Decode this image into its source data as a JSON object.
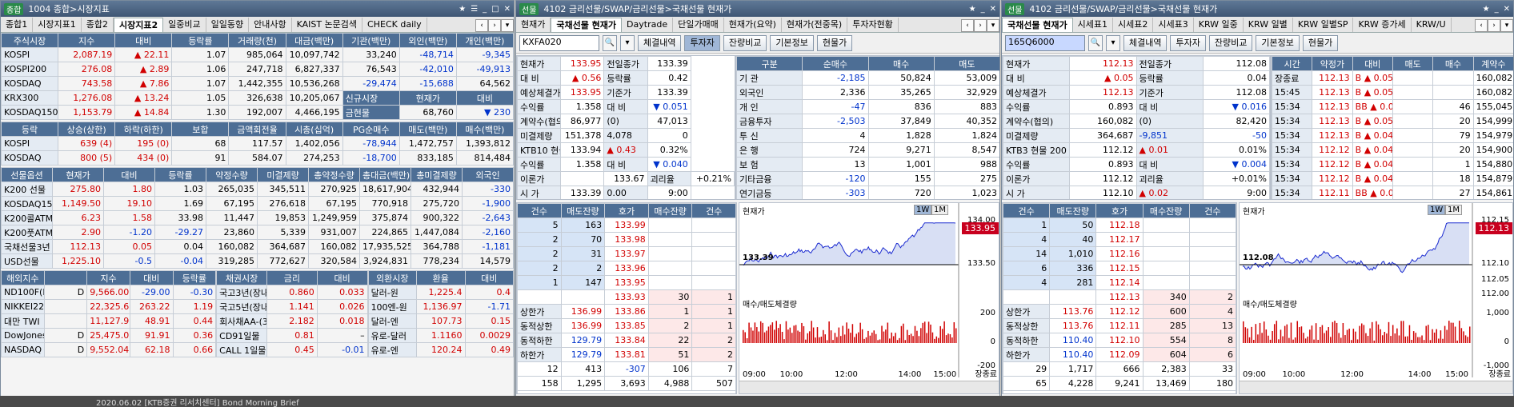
{
  "win1": {
    "title": "1004 종합>시장지표",
    "logo": "종합",
    "tabs": [
      "종합1",
      "시장지표1",
      "종합2",
      "시장지표2",
      "일중비교",
      "일일동향",
      "안내사항",
      "KAIST 논문검색",
      "CHECK daily"
    ],
    "stocks": {
      "headers": [
        "주식시장",
        "지수",
        "대비",
        "등락률",
        "거래량(천)",
        "대금(백만)",
        "기관(백만)",
        "외인(백만)",
        "개인(백만)"
      ],
      "rows": [
        [
          "KOSPI",
          "2,087.19",
          "▲ 22.11",
          "1.07",
          "985,064",
          "10,097,742",
          "33,240",
          "-48,714",
          "-9,345"
        ],
        [
          "KOSPI200",
          "276.08",
          "▲ 2.89",
          "1.06",
          "247,718",
          "6,827,337",
          "76,543",
          "-42,010",
          "-49,913"
        ],
        [
          "KOSDAQ",
          "743.58",
          "▲ 7.86",
          "1.07",
          "1,442,355",
          "10,536,268",
          "-29,474",
          "-15,688",
          "64,562"
        ],
        [
          "KRX300",
          "1,276.08",
          "▲ 13.24",
          "1.05",
          "326,638",
          "10,205,067",
          "신규시장",
          "현재가",
          "대비"
        ],
        [
          "KOSDAQ150",
          "1,153.79",
          "▲ 14.84",
          "1.30",
          "192,007",
          "4,466,195",
          "금현물",
          "68,760",
          "▼ 230"
        ]
      ]
    },
    "adv": {
      "headers": [
        "등락",
        "상승(상한)",
        "하락(하한)",
        "보합",
        "금액회전율",
        "시총(십억)",
        "PG순매수",
        "매도(백만)",
        "매수(백만)"
      ],
      "rows": [
        [
          "KOSPI",
          "639 (4)",
          "195 (0)",
          "68",
          "117.57",
          "1,402,056",
          "-78,944",
          "1,472,757",
          "1,393,812"
        ],
        [
          "KOSDAQ",
          "800 (5)",
          "434 (0)",
          "91",
          "584.07",
          "274,253",
          "-18,700",
          "833,185",
          "814,484"
        ]
      ]
    },
    "fut": {
      "headers": [
        "선물옵션",
        "현재가",
        "대비",
        "등락률",
        "약정수량",
        "미결제량",
        "총약정수량",
        "총대금(백만)",
        "총미결제량",
        "외국인"
      ],
      "rows": [
        [
          "K200 선물",
          "275.80",
          "1.80",
          "1.03",
          "265,035",
          "345,511",
          "270,925",
          "18,617,904",
          "432,944",
          "-330"
        ],
        [
          "KOSDAQ150 선물",
          "1,149.50",
          "19.10",
          "1.69",
          "67,195",
          "276,618",
          "67,195",
          "770,918",
          "275,720",
          "-1,900"
        ],
        [
          "K200콜ATM",
          "6.23",
          "1.58",
          "33.98",
          "11,447",
          "19,853",
          "1,249,959",
          "375,874",
          "900,322",
          "-2,643"
        ],
        [
          "K200풋ATM",
          "2.90",
          "-1.20",
          "-29.27",
          "23,860",
          "5,339",
          "931,007",
          "224,865",
          "1,447,084",
          "-2,160"
        ],
        [
          "국채선물3년",
          "112.13",
          "0.05",
          "0.04",
          "160,082",
          "364,687",
          "160,082",
          "17,935,525",
          "364,788",
          "-1,181"
        ],
        [
          "USD선물",
          "1,225.10",
          "-0.5",
          "-0.04",
          "319,285",
          "772,627",
          "320,584",
          "3,924,831",
          "778,234",
          "14,579"
        ]
      ]
    },
    "ovs": {
      "headers": [
        "해외지수",
        "",
        "지수",
        "대비",
        "등락률"
      ],
      "rows": [
        [
          "ND100F(E)",
          "D",
          "9,566.00",
          "-29.00",
          "-0.30"
        ],
        [
          "NIKKEI225",
          "",
          "22,325.61",
          "263.22",
          "1.19"
        ],
        [
          "대만 TWI",
          "",
          "11,127.93",
          "48.91",
          "0.44"
        ],
        [
          "DowJones",
          "D",
          "25,475.02",
          "91.91",
          "0.36"
        ],
        [
          "NASDAQ",
          "D",
          "9,552.04",
          "62.18",
          "0.66"
        ]
      ]
    },
    "bond": {
      "headers": [
        "채권시장",
        "금리",
        "대비"
      ],
      "rows": [
        [
          "국고3년(장내)",
          "0.860",
          "0.033"
        ],
        [
          "국고5년(장내)",
          "1.141",
          "0.026"
        ],
        [
          "회사채AA-(3)",
          "2.182",
          "0.018"
        ],
        [
          "CD91일물",
          "0.81",
          "–"
        ],
        [
          "CALL 1일물",
          "0.45",
          "-0.01"
        ]
      ]
    },
    "fx": {
      "headers": [
        "외환시장",
        "환율",
        "대비"
      ],
      "rows": [
        [
          "달러-원",
          "1,225.4",
          "0.4"
        ],
        [
          "100엔-원",
          "1,136.97",
          "-1.71"
        ],
        [
          "달러-엔",
          "107.73",
          "0.15"
        ],
        [
          "유로-달러",
          "1.1160",
          "0.0029"
        ],
        [
          "유로-엔",
          "120.24",
          "0.49"
        ]
      ]
    }
  },
  "win2": {
    "title": "4102 금리선물/SWAP/금리선물>국채선물 현재가",
    "logo": "선물",
    "tabs": [
      "현재가",
      "국채선물 현재가",
      "Daytrade",
      "단일가매매",
      "현재가(요약)",
      "현재가(전중목)",
      "투자자현황"
    ],
    "code": "KXFA020",
    "buttons": [
      "체결내역",
      "투자자",
      "잔량비교",
      "기본정보",
      "현물가"
    ],
    "info": [
      [
        "현재가",
        "133.95",
        "전일종가",
        "133.39"
      ],
      [
        "대 비",
        "▲ 0.56",
        "등락률",
        "0.42"
      ],
      [
        "예상체결가",
        "133.95",
        "기준가",
        "133.39"
      ],
      [
        "수익률",
        "1.358",
        "대 비",
        "▼ 0.051"
      ],
      [
        "계약수(협의)",
        "86,977",
        "(0)",
        "47,013"
      ],
      [
        "미결제량",
        "151,378",
        "4,078",
        "0"
      ],
      [
        "KTB10 현물 20",
        "133.94",
        "▲ 0.43",
        "0.32%"
      ],
      [
        "수익률",
        "1.358",
        "대 비",
        "▼ 0.040"
      ],
      [
        "이론가",
        "",
        "133.67",
        "괴리율",
        "+0.21%"
      ],
      [
        "시 가",
        "133.39",
        "0.00",
        "9:00"
      ],
      [
        "고 가",
        "133.95",
        "▲ 0.56",
        "15:45"
      ],
      [
        "저 가",
        "133.11",
        "▼ 0.28",
        "10:08"
      ]
    ],
    "inv": {
      "headers": [
        "구분",
        "순매수",
        "매수",
        "매도"
      ],
      "rows": [
        [
          "기 관",
          "-2,185",
          "50,824",
          "53,009"
        ],
        [
          "외국인",
          "2,336",
          "35,265",
          "32,929"
        ],
        [
          "개 인",
          "-47",
          "836",
          "883"
        ],
        [
          "금융투자",
          "-2,503",
          "37,849",
          "40,352"
        ],
        [
          "투 신",
          "4",
          "1,828",
          "1,824"
        ],
        [
          "은 행",
          "724",
          "9,271",
          "8,547"
        ],
        [
          "보 험",
          "13",
          "1,001",
          "988"
        ],
        [
          "기타금융",
          "-120",
          "155",
          "275"
        ],
        [
          "연기금등",
          "-303",
          "720",
          "1,023"
        ],
        [
          "기타법인",
          "-104",
          "53",
          "157"
        ],
        [
          "합 계",
          "0",
          "86,978",
          "86,978"
        ]
      ]
    },
    "ob": {
      "headers": [
        "건수",
        "매도잔량",
        "호가",
        "매수잔량",
        "건수"
      ],
      "asks": [
        [
          "5",
          "163",
          "133.99"
        ],
        [
          "2",
          "70",
          "133.98"
        ],
        [
          "2",
          "31",
          "133.97"
        ],
        [
          "2",
          "2",
          "133.96"
        ],
        [
          "1",
          "147",
          "133.95"
        ]
      ],
      "bids": [
        [
          "133.93",
          "30",
          "1"
        ],
        [
          "133.86",
          "1",
          "1"
        ],
        [
          "133.85",
          "2",
          "1"
        ],
        [
          "133.84",
          "22",
          "2"
        ],
        [
          "133.81",
          "51",
          "2"
        ]
      ],
      "lim": [
        [
          "상한가",
          "136.99"
        ],
        [
          "동적상한",
          "136.99"
        ],
        [
          "동적하한",
          "129.79"
        ],
        [
          "하한가",
          "129.79"
        ]
      ],
      "tot1": [
        "12",
        "413",
        "-307",
        "106",
        "7"
      ],
      "tot2": [
        "158",
        "1,295",
        "3,693",
        "4,988",
        "507"
      ],
      "footer": "잔량비교"
    },
    "chart": {
      "title": "현재가",
      "price": "133.95",
      "ref": "133.39",
      "y1": "134.00",
      "y2": "133.50",
      "vol": "매수/매도체결량",
      "v1": "200",
      "v2": "0",
      "v3": "-200",
      "x": [
        "09:00",
        "10:00",
        "12:00",
        "14:00",
        "15:00"
      ],
      "close": "장종료",
      "bt": [
        "1W",
        "1M"
      ]
    }
  },
  "win3": {
    "title": "4102 금리선물/SWAP/금리선물>국채선물 현재가",
    "logo": "선물",
    "tabs": [
      "국채선물 현재가",
      "시세표1",
      "시세표2",
      "시세표3",
      "KRW 일중",
      "KRW 일별",
      "KRW 일별SP",
      "KRW 증가세",
      "KRW/U"
    ],
    "code": "165Q6000",
    "buttons": [
      "체결내역",
      "투자자",
      "잔량비교",
      "기본정보",
      "현물가"
    ],
    "info": [
      [
        "현재가",
        "112.13",
        "전일종가",
        "112.08"
      ],
      [
        "대 비",
        "▲ 0.05",
        "등락률",
        "0.04"
      ],
      [
        "예상체결가",
        "112.13",
        "기준가",
        "112.08"
      ],
      [
        "수익률",
        "0.893",
        "대 비",
        "▼ 0.016"
      ],
      [
        "계약수(협의)",
        "160,082",
        "(0)",
        "82,420"
      ],
      [
        "미결제량",
        "364,687",
        "-9,851",
        "-50"
      ],
      [
        "KTB3 현물 200",
        "112.12",
        "▲ 0.01",
        "0.01%"
      ],
      [
        "수익률",
        "0.893",
        "대 비",
        "▼ 0.004"
      ],
      [
        "이론가",
        "112.12",
        "괴리율",
        "+0.01%"
      ],
      [
        "시 가",
        "112.10",
        "▲ 0.02",
        "9:00"
      ],
      [
        "고 가",
        "112.13",
        "▲ 0.05",
        "15:45"
      ],
      [
        "저 가",
        "111.98",
        "▼ 0.10",
        "14:15"
      ]
    ],
    "ticks": {
      "headers": [
        "시간",
        "약정가",
        "대비",
        "매도",
        "매수",
        "계약수"
      ],
      "rows": [
        [
          "장종료",
          "112.13",
          "B ▲ 0.05",
          "",
          "",
          "160,082"
        ],
        [
          "15:45",
          "112.13",
          "B ▲ 0.05",
          "",
          "",
          "160,082"
        ],
        [
          "15:34",
          "112.13",
          "BB ▲ 0.05",
          "",
          "46",
          "155,045"
        ],
        [
          "15:34",
          "112.13",
          "B ▲ 0.05",
          "",
          "20",
          "154,999"
        ],
        [
          "15:34",
          "112.13",
          "B ▲ 0.04",
          "",
          "79",
          "154,979"
        ],
        [
          "15:34",
          "112.12",
          "B ▲ 0.04",
          "",
          "20",
          "154,900"
        ],
        [
          "15:34",
          "112.12",
          "B ▲ 0.04",
          "",
          "1",
          "154,880"
        ],
        [
          "15:34",
          "112.12",
          "B ▲ 0.04",
          "",
          "18",
          "154,879"
        ],
        [
          "15:34",
          "112.11",
          "BB ▲ 0.03",
          "",
          "27",
          "154,861"
        ],
        [
          "15:34",
          "112.11",
          "B ▲ 0.03",
          "",
          "50",
          "154,834"
        ]
      ]
    },
    "ob": {
      "headers": [
        "건수",
        "매도잔량",
        "호가",
        "매수잔량",
        "건수"
      ],
      "asks": [
        [
          "1",
          "50",
          "112.18"
        ],
        [
          "4",
          "40",
          "112.17"
        ],
        [
          "14",
          "1,010",
          "112.16"
        ],
        [
          "6",
          "336",
          "112.15"
        ],
        [
          "4",
          "281",
          "112.14"
        ]
      ],
      "bids": [
        [
          "112.13",
          "340",
          "2"
        ],
        [
          "112.12",
          "600",
          "4"
        ],
        [
          "112.11",
          "285",
          "13"
        ],
        [
          "112.10",
          "554",
          "8"
        ],
        [
          "112.09",
          "604",
          "6"
        ]
      ],
      "lim": [
        [
          "상한가",
          "113.76"
        ],
        [
          "동적상한",
          "113.76"
        ],
        [
          "동적하한",
          "110.40"
        ],
        [
          "하한가",
          "110.40"
        ]
      ],
      "tot1": [
        "29",
        "1,717",
        "666",
        "2,383",
        "33"
      ],
      "tot2": [
        "65",
        "4,228",
        "9,241",
        "13,469",
        "180"
      ],
      "footer": "잔량비교"
    },
    "chart": {
      "title": "현재가",
      "price": "112.13",
      "ref": "112.08",
      "y1": "112.15",
      "y2": "112.10",
      "y3": "112.05",
      "y4": "112.00",
      "vol": "매수/매도체결량",
      "v1": "1,000",
      "v2": "0",
      "v3": "-1,000",
      "x": [
        "09:00",
        "10:00",
        "12:00",
        "14:00",
        "15:00"
      ],
      "close": "장종료",
      "bt": [
        "1W",
        "1M"
      ]
    }
  },
  "status": {
    "date": "2020.06.02",
    "msg": "[KTB증권 리서치센터] Bond Morning Brief"
  }
}
